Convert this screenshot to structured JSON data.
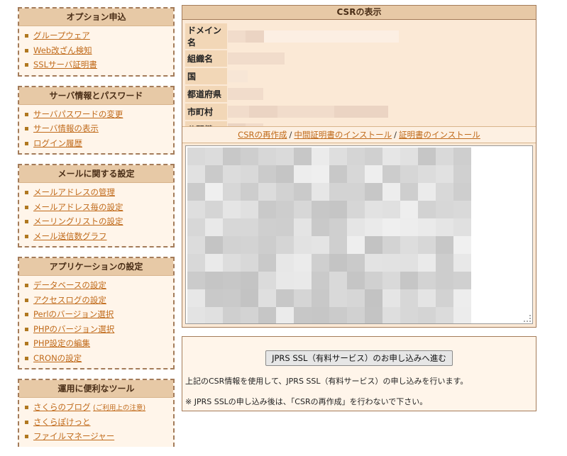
{
  "sidebar": {
    "sections": [
      {
        "title": "オプション申込",
        "items": [
          {
            "label": "グループウェア"
          },
          {
            "label": "Web改ざん検知"
          },
          {
            "label": "SSLサーバ証明書"
          }
        ]
      },
      {
        "title": "サーバ情報とパスワード",
        "items": [
          {
            "label": "サーバパスワードの変更"
          },
          {
            "label": "サーバ情報の表示"
          },
          {
            "label": "ログイン履歴"
          }
        ]
      },
      {
        "title": "メールに関する設定",
        "items": [
          {
            "label": "メールアドレスの管理"
          },
          {
            "label": "メールアドレス毎の設定"
          },
          {
            "label": "メーリングリストの設定"
          },
          {
            "label": "メール送信数グラフ"
          }
        ]
      },
      {
        "title": "アプリケーションの設定",
        "items": [
          {
            "label": "データベースの設定"
          },
          {
            "label": "アクセスログの設定"
          },
          {
            "label": "Perlのバージョン選択"
          },
          {
            "label": "PHPのバージョン選択"
          },
          {
            "label": "PHP設定の編集"
          },
          {
            "label": "CRONの設定"
          }
        ]
      },
      {
        "title": "運用に便利なツール",
        "items": [
          {
            "label": "さくらのブログ",
            "note": "(ご利用上の注意)"
          },
          {
            "label": "さくらぽけっと"
          },
          {
            "label": "ファイルマネージャー"
          }
        ]
      }
    ]
  },
  "csr": {
    "title": "CSRの表示",
    "fields": [
      {
        "label": "ドメイン名"
      },
      {
        "label": "組織名"
      },
      {
        "label": "国"
      },
      {
        "label": "都道府県"
      },
      {
        "label": "市町村"
      },
      {
        "label": "公開鍵"
      }
    ],
    "links": [
      "CSRの再作成",
      "中間証明書のインストール",
      "証明書のインストール"
    ],
    "link_separator": "/"
  },
  "apply": {
    "button_label": "JPRS SSL（有料サービス）のお申し込みへ進む",
    "description": "上記のCSR情報を使用して、JPRS SSL（有料サービス）の申し込みを行います。",
    "note": "※ JPRS SSLの申し込み後は、「CSRの再作成」を行わないで下さい。"
  },
  "colors": {
    "accent_link": "#c06a1a",
    "header_bg": "#e7c9a6",
    "panel_bg": "#fbe9d6",
    "border": "#a47c5a"
  }
}
